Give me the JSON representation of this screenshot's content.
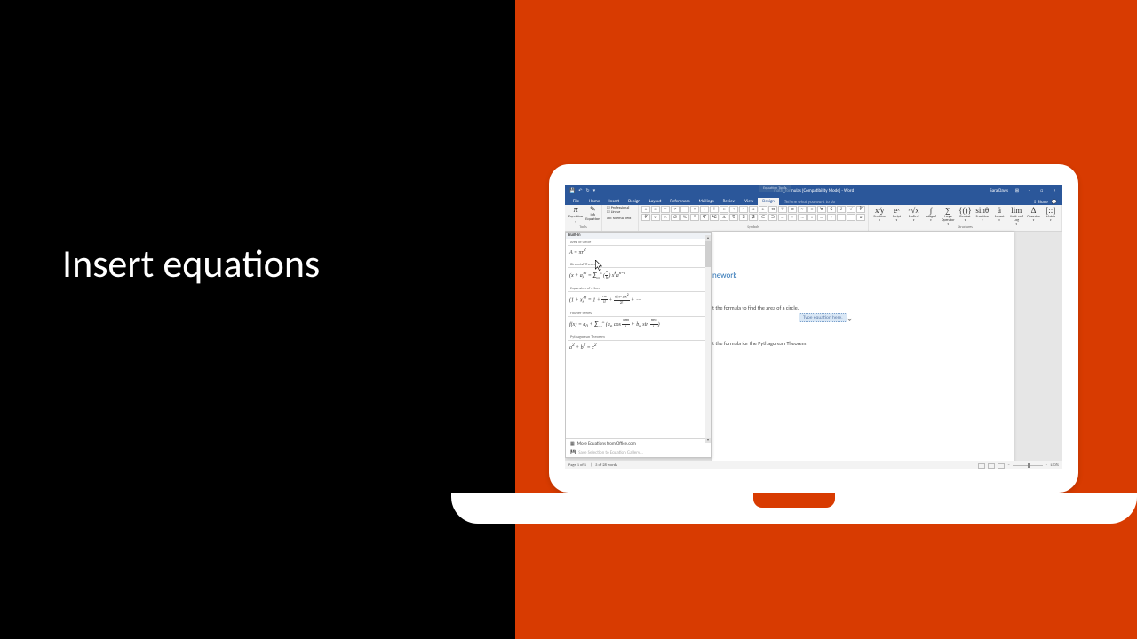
{
  "headline": "Insert equations",
  "title_bar": {
    "doc_title": "math_formulas [Compatibility Mode] - Word",
    "contextual_tab_group": "Equation Tools",
    "user": "Sara Davis"
  },
  "ribbon_tabs": {
    "file": "File",
    "home": "Home",
    "insert": "Insert",
    "design_doc": "Design",
    "layout": "Layout",
    "references": "References",
    "mailings": "Mailings",
    "review": "Review",
    "view": "View",
    "design_eq": "Design",
    "tell_me": "Tell me what you want to do",
    "share": "Share"
  },
  "tools_group": {
    "equation": "Equation",
    "ink": "Ink\nEquation",
    "professional": "Professional",
    "linear": "Linear",
    "normal_text": "Normal Text",
    "label": "Tools"
  },
  "symbols": {
    "label": "Symbols",
    "row1": [
      "±",
      "∞",
      "=",
      "≠",
      "~",
      "×",
      "÷",
      "!",
      "∝",
      "<",
      ">",
      "≤",
      "≥",
      "≪",
      "∓",
      "≅",
      "≈",
      "≡",
      "∀",
      "∁",
      "∂",
      "√",
      "∛"
    ],
    "row2": [
      "∜",
      "∪",
      "∩",
      "∅",
      "%",
      "°",
      "℉",
      "℃",
      "∆",
      "∇",
      "∃",
      "∄",
      "∈",
      "∋",
      "←",
      "↑",
      "→",
      "↓",
      "↔",
      "+",
      "−",
      "·",
      "α"
    ]
  },
  "structures": {
    "label": "Structures",
    "items": [
      {
        "glyph": "x⁄y",
        "label": "Fraction"
      },
      {
        "glyph": "eˣ",
        "label": "Script"
      },
      {
        "glyph": "ⁿ√x",
        "label": "Radical"
      },
      {
        "glyph": "∫",
        "label": "Integral"
      },
      {
        "glyph": "∑",
        "label": "Large\nOperator"
      },
      {
        "glyph": "{()}",
        "label": "Bracket"
      },
      {
        "glyph": "sinθ",
        "label": "Function"
      },
      {
        "glyph": "ä",
        "label": "Accent"
      },
      {
        "glyph": "lim",
        "label": "Limit and\nLog"
      },
      {
        "glyph": "Δ",
        "label": "Operator"
      },
      {
        "glyph": "[::]",
        "label": "Matrix"
      }
    ]
  },
  "gallery": {
    "built_in": "Built-In",
    "items": [
      {
        "title": "Area of Circle",
        "formula_html": "A = πr²"
      },
      {
        "title": "Binomial Theorem",
        "formula_html": "(x + a)ⁿ = Σ (ⁿₖ) xᵏaⁿ⁻ᵏ"
      },
      {
        "title": "Expansion of a Sum",
        "formula_html": "(1 + x)ⁿ = 1 + nx/1! + n(n−1)x²/2! + ⋯"
      },
      {
        "title": "Fourier Series",
        "formula_html": "f(x) = a₀ + Σ (aₙ cos nπx/L + bₙ sin nπx/L)"
      },
      {
        "title": "Pythagorean Theorem",
        "formula_html": "a² + b² = c²"
      }
    ],
    "more": "More Equations from Office.com",
    "save_sel": "Save Selection to Equation Gallery..."
  },
  "document": {
    "heading_visible": "nework",
    "line1": "t the formula to find the area of a circle.",
    "placeholder": "Type equation here.",
    "line2": "t the formula for the Pythagorean Theorem."
  },
  "status": {
    "page": "Page 1 of 1",
    "words": "3 of 28 words",
    "zoom": "130%"
  }
}
